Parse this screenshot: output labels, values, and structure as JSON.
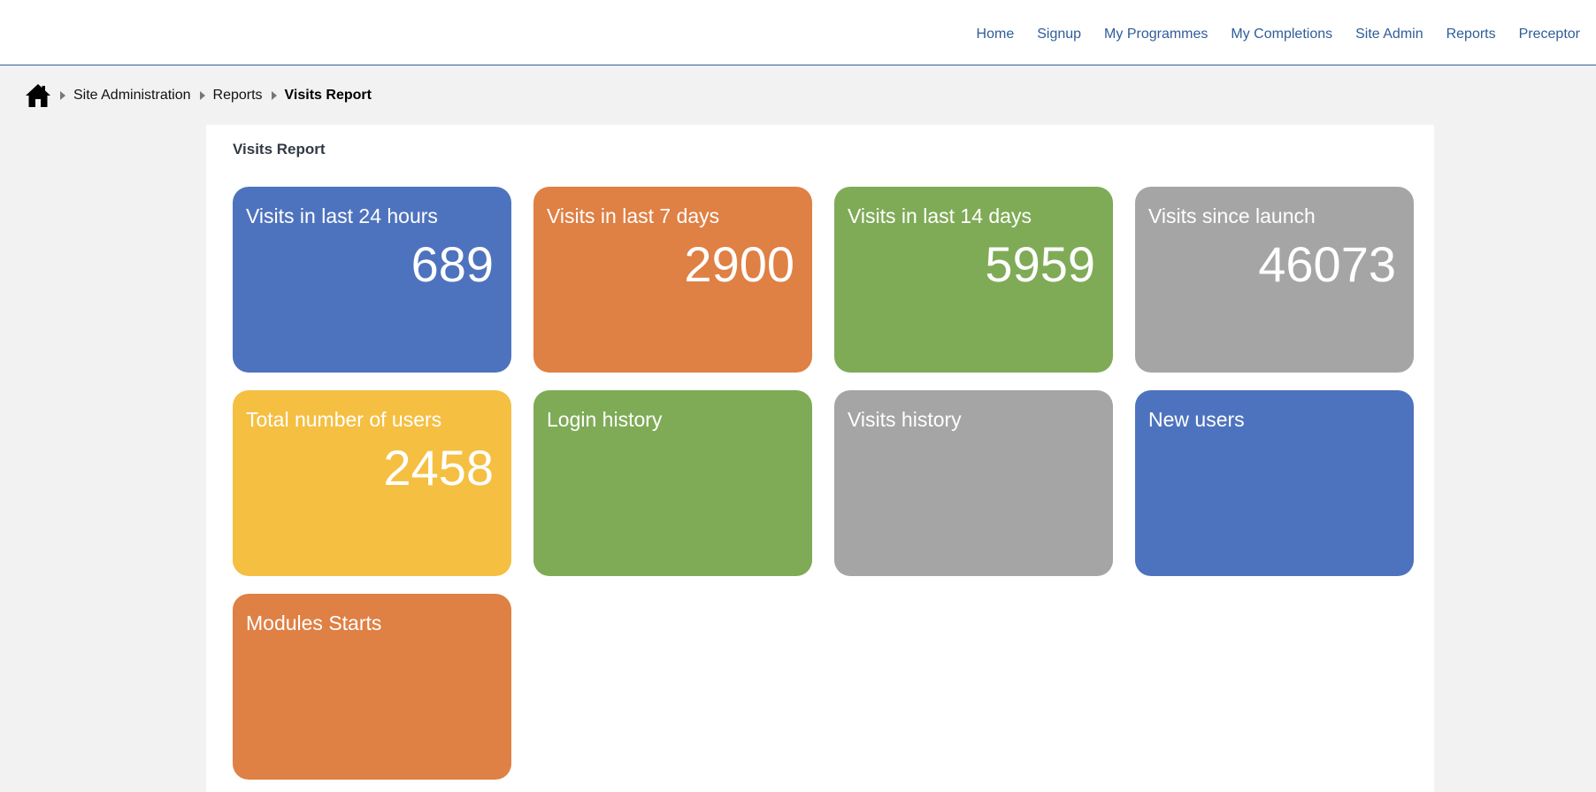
{
  "nav": {
    "items": [
      {
        "label": "Home"
      },
      {
        "label": "Signup"
      },
      {
        "label": "My Programmes"
      },
      {
        "label": "My Completions"
      },
      {
        "label": "Site Admin"
      },
      {
        "label": "Reports"
      },
      {
        "label": "Preceptor"
      }
    ],
    "link_color": "#2f5d99"
  },
  "breadcrumb": {
    "home_icon": "home-icon",
    "items": [
      {
        "label": "Site Administration"
      },
      {
        "label": "Reports"
      },
      {
        "label": "Visits Report"
      }
    ]
  },
  "page": {
    "title": "Visits Report"
  },
  "tiles": [
    {
      "title": "Visits in last 24 hours",
      "value": "689",
      "color": "#4e73be"
    },
    {
      "title": "Visits in last 7 days",
      "value": "2900",
      "color": "#df8044"
    },
    {
      "title": "Visits in last 14 days",
      "value": "5959",
      "color": "#7fab57"
    },
    {
      "title": "Visits since launch",
      "value": "46073",
      "color": "#a5a5a5"
    },
    {
      "title": "Total number of users",
      "value": "2458",
      "color": "#f5bf42"
    },
    {
      "title": "Login history",
      "color": "#7fab57"
    },
    {
      "title": "Visits history",
      "color": "#a5a5a5"
    },
    {
      "title": "New users",
      "color": "#4e73be"
    },
    {
      "title": "Modules Starts",
      "color": "#df8044"
    }
  ]
}
